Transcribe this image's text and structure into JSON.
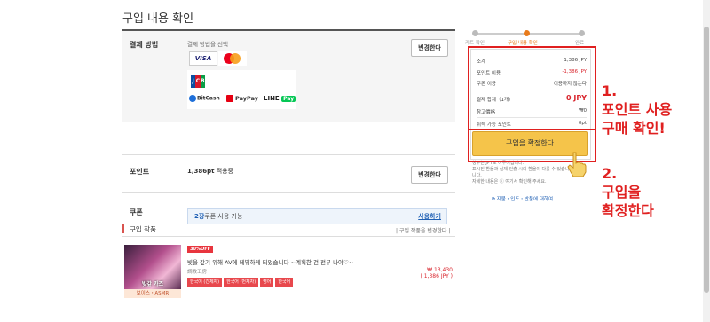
{
  "page": {
    "title": "구입 내용 확인"
  },
  "payment": {
    "label": "결제 방법",
    "select_label": "결제 방법을 선택",
    "visa": "VISA",
    "mastercard": "mastercard",
    "jcb": [
      "J",
      "C",
      "B"
    ],
    "bitcash": "BitCash",
    "paypay": "PayPay",
    "line": "LINE",
    "line_pay": "Pay",
    "change_btn": "변경한다"
  },
  "points": {
    "label": "포인트",
    "value": "1,386pt",
    "suffix": " 적용중",
    "change_btn": "변경한다"
  },
  "coupon": {
    "label": "쿠폰",
    "count": "2장",
    "text": "쿠폰 사용 가능",
    "link": "사용하기"
  },
  "works": {
    "section_title": "구입 작품",
    "change_link": "| 구입 작품을 변경한다 |",
    "item": {
      "badge": "30%OFF",
      "title": "빚을 갚기 위해 AV에 데뷔하게 되었습니다 ~계획한 건 전부 나야♡~",
      "circle": "調教工房",
      "tags": [
        "한국어 (간체자)",
        "한국어 (번체자)",
        "영어",
        "한국어"
      ],
      "price": "₩ 13,430",
      "price_jpy": "( 1,386 JPY )",
      "thumb_caption": "빚갚 카즈",
      "category": "보이스・ASMR"
    }
  },
  "steps": [
    {
      "label": "카트 확인",
      "active": false
    },
    {
      "label": "구입 내용 확인",
      "active": true
    },
    {
      "label": "완료",
      "active": false
    }
  ],
  "summary": {
    "subtotal_label": "소계",
    "subtotal": "1,386 JPY",
    "points_label": "포인트 이용",
    "points": "-1,386 JPY",
    "coupon_label": "쿠폰 이용",
    "coupon": "이용하지 않는다",
    "total_label": "결제 합계（1개）",
    "total": "0 JPY",
    "ref_label": "참고價格",
    "ref": "₩0",
    "earn_label": "취득 가능 포인트",
    "earn": "0pt"
  },
  "confirm_button": "구입을 확정한다",
  "notes": [
    "청구는 JPY로 이루어집니다.",
    "표시된 환율과 실제 인출 시의 환율이 다를 수 있습니다.",
    "니다.",
    "자세한 내용은 ⓘ 여기서 확인해 주세요."
  ],
  "bottom_link": "⧉ 지불・인도・반품에 대하여",
  "annotations": {
    "a1_line1": "1.",
    "a1_line2": "포인트 사용",
    "a1_line3": "구매 확인!",
    "a2_line1": "2.",
    "a2_line2": "구입을",
    "a2_line3": "확정한다"
  },
  "colors": {
    "accent_red": "#e02020",
    "button_yellow": "#f5c44a",
    "step_active": "#e87b1c"
  }
}
